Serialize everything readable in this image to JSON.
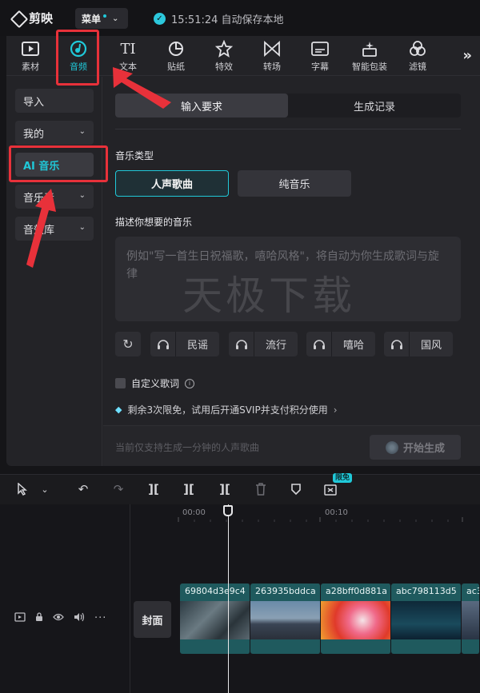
{
  "app": {
    "name": "剪映",
    "menu_label": "菜单",
    "save_status": "15:51:24 自动保存本地"
  },
  "toolbar": {
    "items": [
      {
        "label": "素材",
        "icon": "media-icon"
      },
      {
        "label": "音频",
        "icon": "audio-icon"
      },
      {
        "label": "文本",
        "icon": "text-icon"
      },
      {
        "label": "贴纸",
        "icon": "sticker-icon"
      },
      {
        "label": "特效",
        "icon": "effects-icon"
      },
      {
        "label": "转场",
        "icon": "transition-icon"
      },
      {
        "label": "字幕",
        "icon": "subtitle-icon"
      },
      {
        "label": "智能包装",
        "icon": "smart-pack-icon"
      },
      {
        "label": "滤镜",
        "icon": "filter-icon"
      }
    ],
    "active": "音频",
    "more": "»"
  },
  "sidebar": {
    "items": [
      {
        "label": "导入"
      },
      {
        "label": "我的"
      },
      {
        "label": "AI 音乐"
      },
      {
        "label": "音乐素"
      },
      {
        "label": "音效库"
      }
    ]
  },
  "tabs": {
    "input": "输入要求",
    "history": "生成记录"
  },
  "music_type": {
    "label": "音乐类型",
    "vocal": "人声歌曲",
    "instrumental": "纯音乐"
  },
  "describe": {
    "label": "描述你想要的音乐",
    "placeholder": "例如\"写一首生日祝福歌，嘻哈风格\"，将自动为你生成歌词与旋律"
  },
  "watermark": "天极下载",
  "styles": [
    "民谣",
    "流行",
    "嘻哈",
    "国风"
  ],
  "custom_lyrics": "自定义歌词",
  "promo": "剩余3次限免，试用后开通SVIP并支付积分使用",
  "bottom": {
    "note": "当前仅支持生成一分钟的人声歌曲",
    "generate": "开始生成"
  },
  "timeline": {
    "free_badge": "限免",
    "ticks": [
      "00:00",
      "00:10"
    ],
    "cover": "封面",
    "clips": [
      {
        "name": "69804d3e9c4",
        "tone": "#3a4a52"
      },
      {
        "name": "263935bddca",
        "tone": "#4a5868"
      },
      {
        "name": "a28bff0d881a",
        "tone": "#d84a2a"
      },
      {
        "name": "abc798113d5",
        "tone": "#163c50"
      },
      {
        "name": "ac3",
        "tone": "#3a4a62"
      }
    ]
  },
  "colors": {
    "accent": "#20c9d9",
    "annotation": "#e8313a"
  }
}
